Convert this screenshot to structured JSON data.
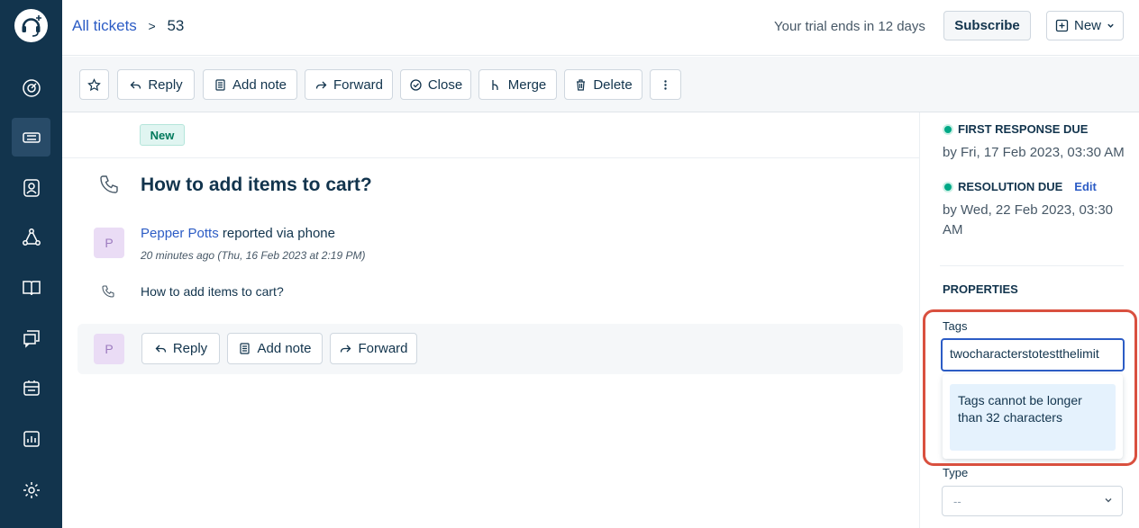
{
  "breadcrumb": {
    "all_tickets": "All tickets",
    "separator": ">",
    "ticket_id": "53"
  },
  "header": {
    "trial": "Your trial ends in 12 days",
    "subscribe": "Subscribe",
    "new": "New"
  },
  "toolbar": {
    "reply": "Reply",
    "add_note": "Add note",
    "forward": "Forward",
    "close": "Close",
    "merge": "Merge",
    "delete": "Delete"
  },
  "ticket": {
    "status": "New",
    "subject": "How to add items to cart?",
    "avatar_initial": "P",
    "reporter_name": "Pepper Potts",
    "reporter_via": "reported via phone",
    "time": "20 minutes ago (Thu, 16 Feb 2023 at 2:19 PM)",
    "description": "How to add items to cart?"
  },
  "reply_bar": {
    "reply": "Reply",
    "add_note": "Add note",
    "forward": "Forward"
  },
  "sla": {
    "first_response_title": "FIRST RESPONSE DUE",
    "first_response_value": "by Fri, 17 Feb 2023, 03:30 AM",
    "resolution_title": "RESOLUTION DUE",
    "resolution_edit": "Edit",
    "resolution_value": "by Wed, 22 Feb 2023, 03:30 AM"
  },
  "properties": {
    "heading": "PROPERTIES",
    "tags_label": "Tags",
    "tags_value": "twocharacterstotestthelimit",
    "tags_error": "Tags cannot be longer than 32 characters",
    "type_label": "Type",
    "type_value": "--"
  },
  "colors": {
    "sidebar": "#12344d",
    "link": "#2c5cc5",
    "highlight": "#d9503f",
    "sla_green": "#00a886"
  }
}
